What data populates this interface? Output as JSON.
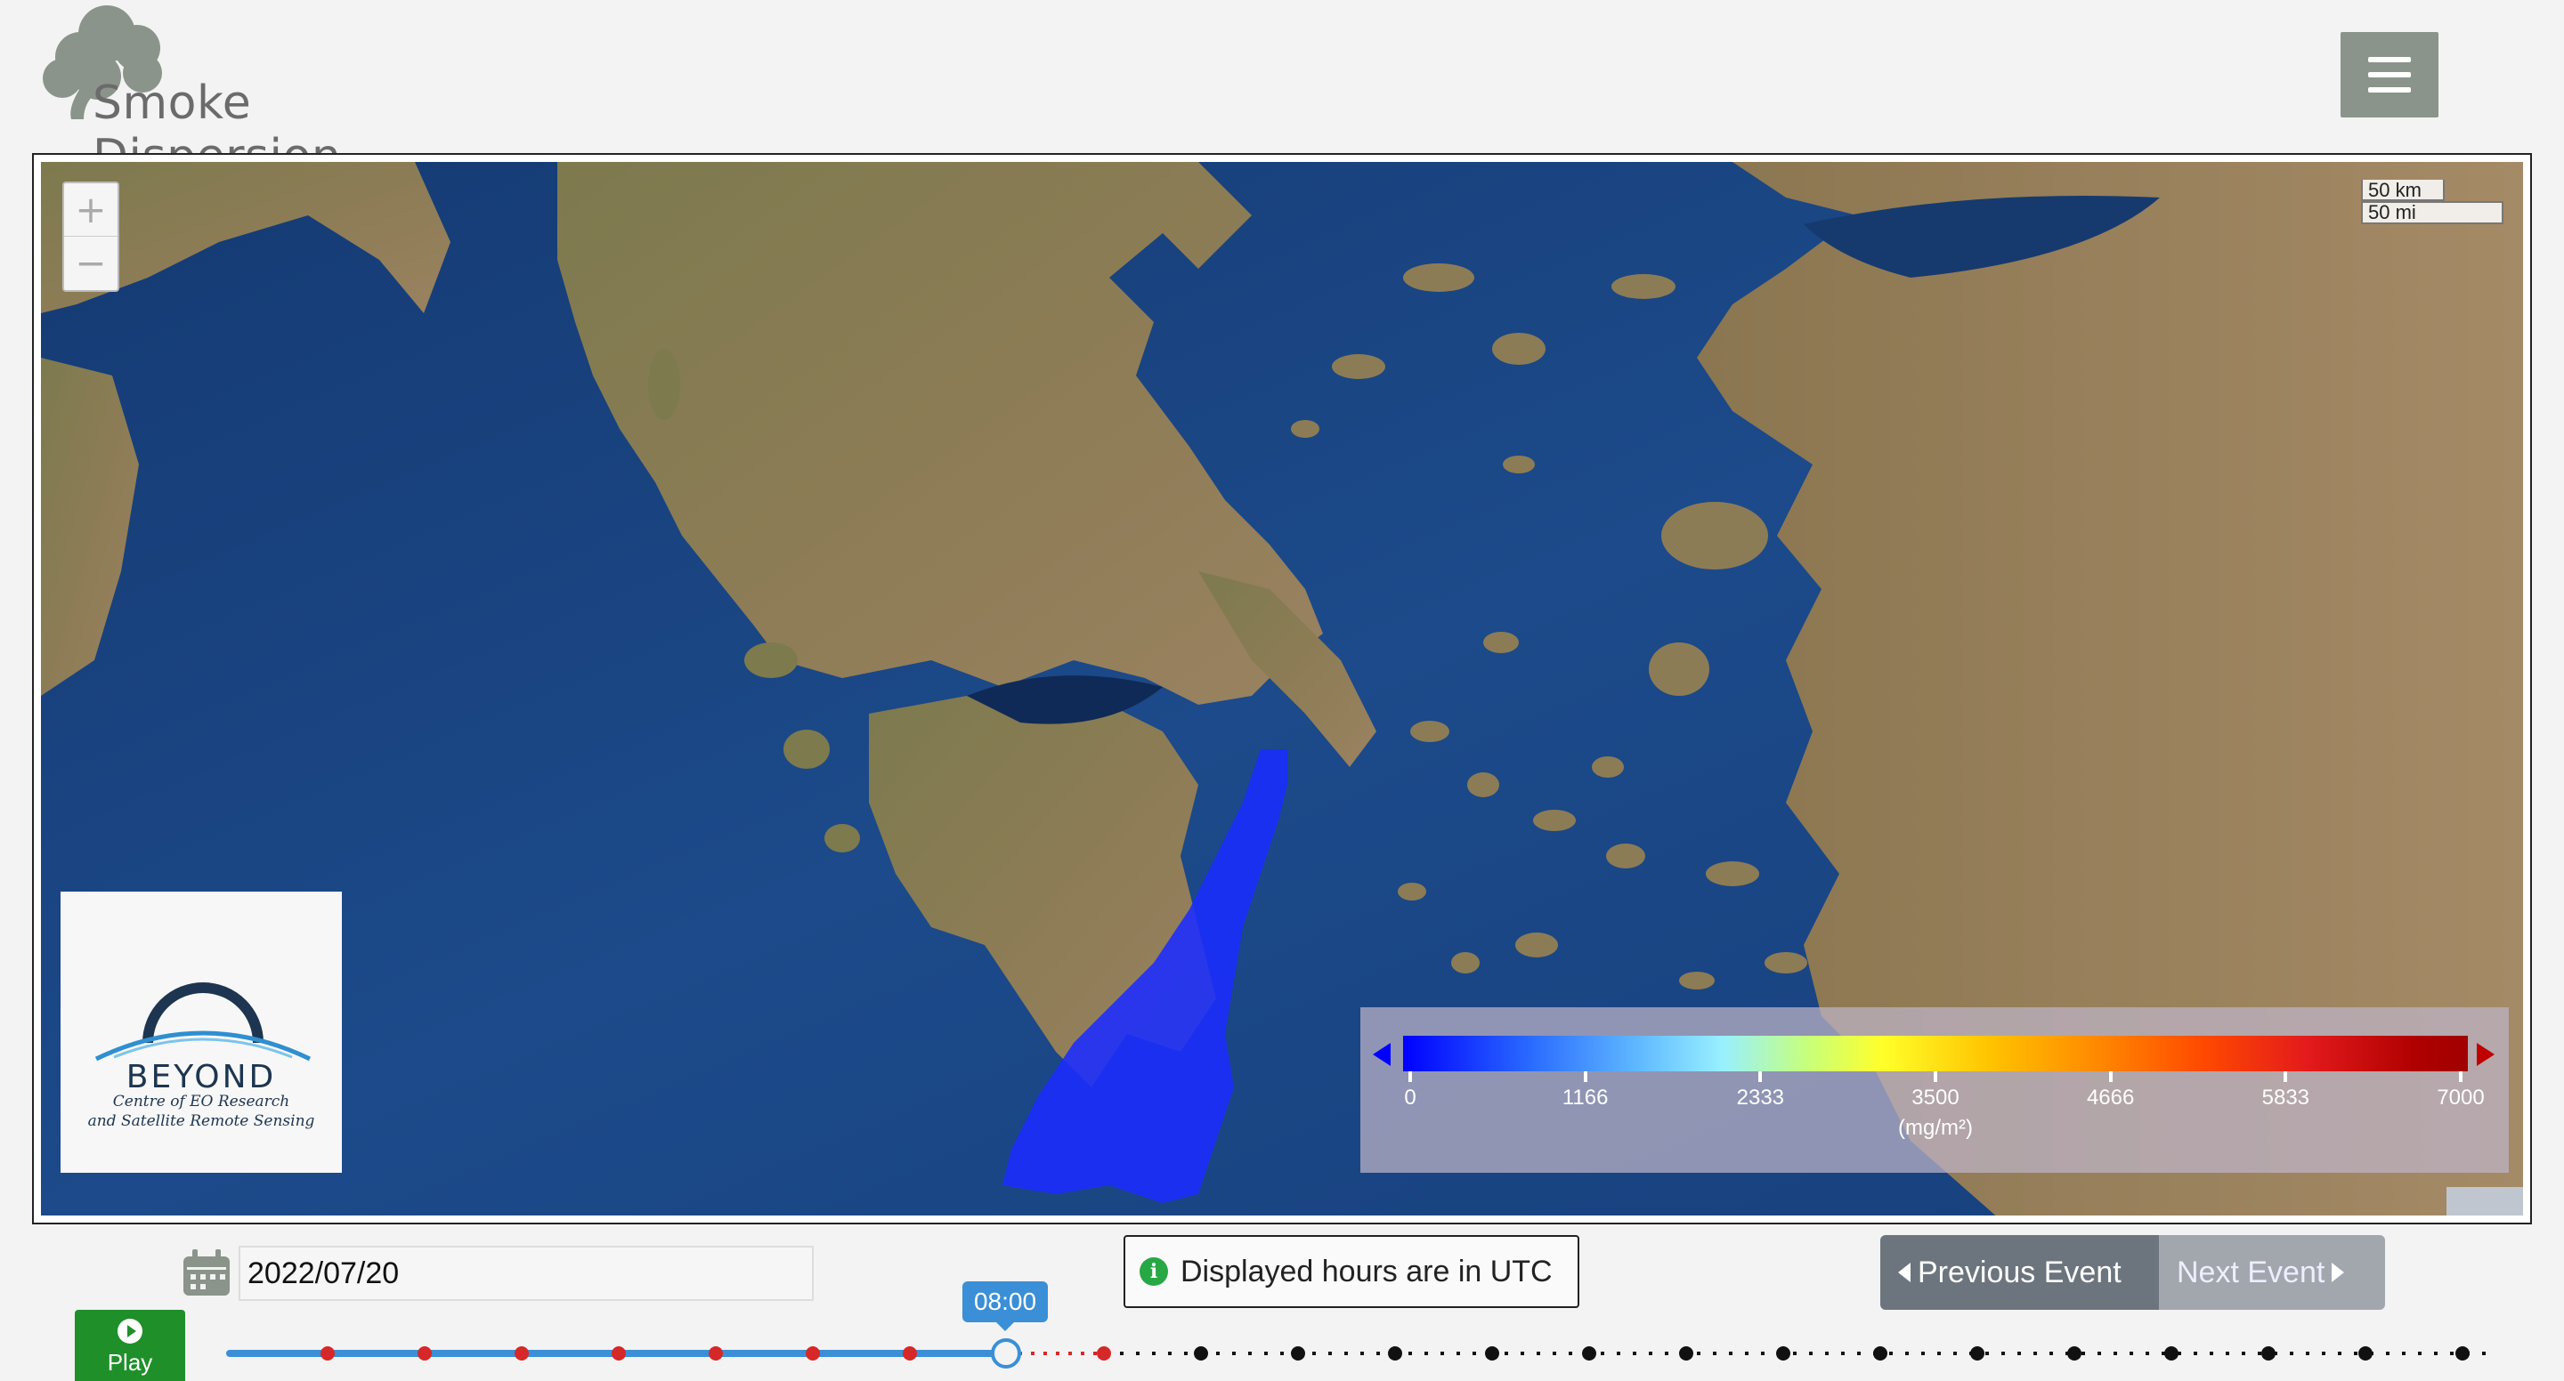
{
  "app": {
    "title": "Smoke Dispersion",
    "menu_icon": "hamburger-icon"
  },
  "map": {
    "zoom_in_label": "+",
    "zoom_out_label": "−",
    "scale_km": "50 km",
    "scale_mi": "50 mi",
    "basemap": "satellite",
    "plume_color": "#1a2cff"
  },
  "logo_beyond": {
    "title": "BEYOND",
    "subtitle_line1": "Centre of EO Research",
    "subtitle_line2": "and Satellite Remote Sensing"
  },
  "legend": {
    "ticks": [
      "0",
      "1166",
      "2333",
      "3500",
      "4666",
      "5833",
      "7000"
    ],
    "unit": "(mg/m²)"
  },
  "controls": {
    "date_value": "2022/07/20",
    "utc_notice": "Displayed hours are in UTC",
    "prev_event": "Previous Event",
    "next_event": "Next Event",
    "play_label": "Play",
    "current_time": "08:00"
  },
  "colors": {
    "play_button": "#1f8f2a",
    "prev_button": "#6c757d",
    "next_button": "#a2a7ad",
    "time_bubble": "#3b8fd6",
    "timeline_past": "#3b8fd6",
    "timeline_event_dot": "#d62828",
    "timeline_future_dot": "#111111"
  }
}
